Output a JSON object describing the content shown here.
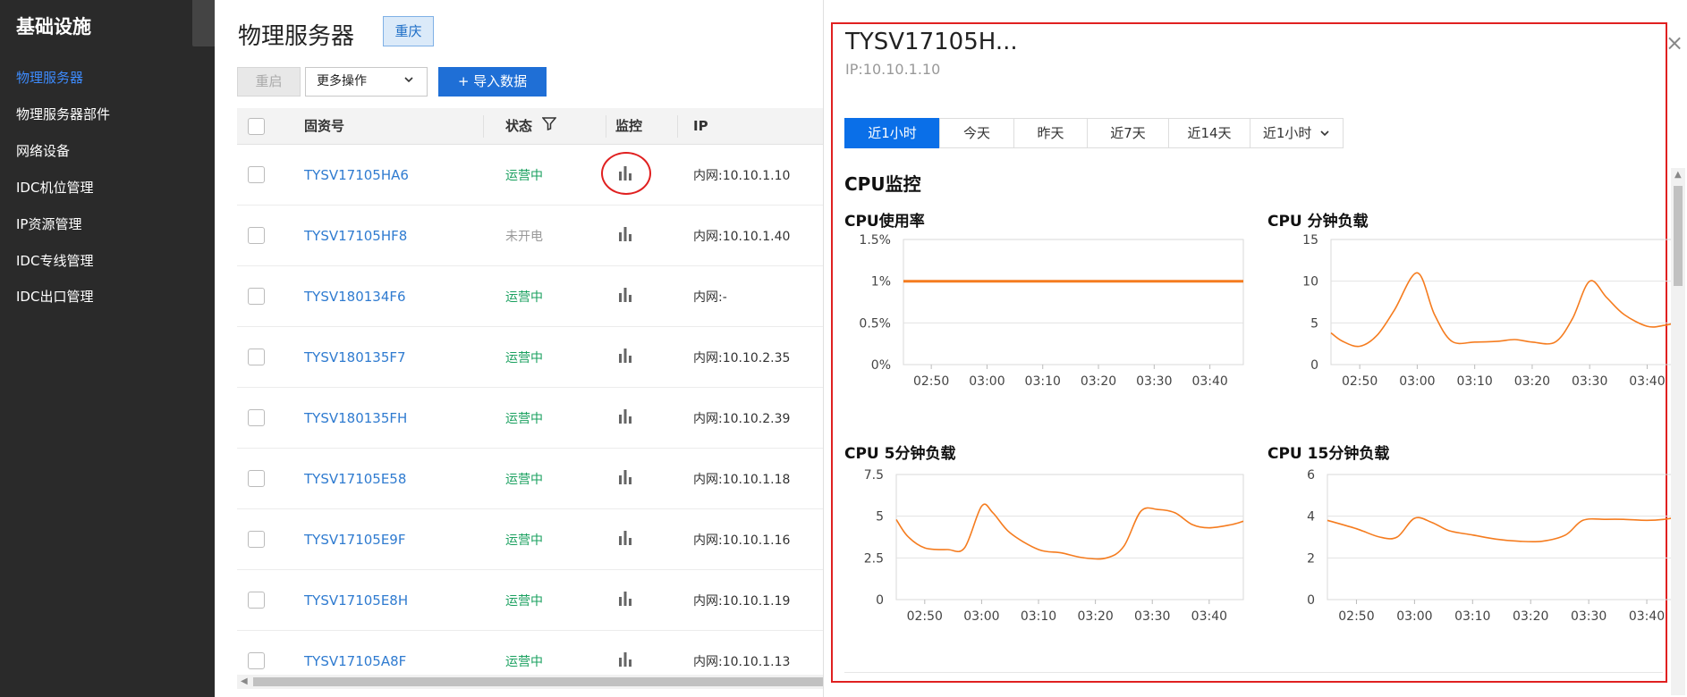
{
  "sidebar": {
    "title": "基础设施",
    "items": [
      {
        "label": "物理服务器",
        "active": true
      },
      {
        "label": "物理服务器部件"
      },
      {
        "label": "网络设备"
      },
      {
        "label": "IDC机位管理"
      },
      {
        "label": "IP资源管理"
      },
      {
        "label": "IDC专线管理"
      },
      {
        "label": "IDC出口管理"
      }
    ]
  },
  "main": {
    "title": "物理服务器",
    "region": "重庆",
    "toolbar": {
      "restart": "重启",
      "more_ops": "更多操作",
      "import": "+ 导入数据"
    },
    "table": {
      "headers": {
        "asset": "固资号",
        "status": "状态",
        "monitor": "监控",
        "ip": "IP"
      },
      "rows": [
        {
          "asset": "TYSV17105HA6",
          "status": "运营中",
          "status_type": "run",
          "ip": "内网:10.10.1.10"
        },
        {
          "asset": "TYSV17105HF8",
          "status": "未开电",
          "status_type": "off",
          "ip": "内网:10.10.1.40"
        },
        {
          "asset": "TYSV180134F6",
          "status": "运营中",
          "status_type": "run",
          "ip": "内网:-"
        },
        {
          "asset": "TYSV180135F7",
          "status": "运营中",
          "status_type": "run",
          "ip": "内网:10.10.2.35"
        },
        {
          "asset": "TYSV180135FH",
          "status": "运营中",
          "status_type": "run",
          "ip": "内网:10.10.2.39"
        },
        {
          "asset": "TYSV17105E58",
          "status": "运营中",
          "status_type": "run",
          "ip": "内网:10.10.1.18"
        },
        {
          "asset": "TYSV17105E9F",
          "status": "运营中",
          "status_type": "run",
          "ip": "内网:10.10.1.16"
        },
        {
          "asset": "TYSV17105E8H",
          "status": "运营中",
          "status_type": "run",
          "ip": "内网:10.10.1.19"
        },
        {
          "asset": "TYSV17105A8F",
          "status": "运营中",
          "status_type": "run",
          "ip": "内网:10.10.1.13"
        }
      ]
    }
  },
  "panel": {
    "title": "TYSV17105H...",
    "ip": "IP:10.10.1.10",
    "tabs": [
      {
        "label": "近1小时",
        "active": true
      },
      {
        "label": "今天"
      },
      {
        "label": "昨天"
      },
      {
        "label": "近7天"
      },
      {
        "label": "近14天"
      },
      {
        "label": "近1小时",
        "dropdown": true
      }
    ],
    "section_title": "CPU监控",
    "close": "×"
  },
  "colors": {
    "line": "#f57c1f",
    "accent": "#0a6fe8",
    "link": "#2f7bd0",
    "running": "#1aa05f",
    "highlight": "#e02020"
  },
  "chart_data": [
    {
      "type": "line",
      "title": "CPU使用率",
      "x": [
        "02:45",
        "02:50",
        "03:00",
        "03:10",
        "03:20",
        "03:30",
        "03:40",
        "03:46"
      ],
      "xticks": [
        "02:50",
        "03:00",
        "03:10",
        "03:20",
        "03:30",
        "03:40"
      ],
      "yticks": [
        "1.5%",
        "1%",
        "0.5%",
        "0%"
      ],
      "ylim": [
        0,
        1.5
      ],
      "series": [
        {
          "values": [
            1,
            1,
            1,
            1,
            1,
            1,
            1,
            1
          ]
        }
      ],
      "grid": true
    },
    {
      "type": "line",
      "title": "CPU 分钟负载",
      "x": [
        "02:45",
        "02:47",
        "02:50",
        "02:53",
        "02:56",
        "03:00",
        "03:03",
        "03:06",
        "03:10",
        "03:14",
        "03:17",
        "03:20",
        "03:24",
        "03:27",
        "03:30",
        "03:33",
        "03:36",
        "03:40",
        "03:43",
        "03:46"
      ],
      "xticks": [
        "02:50",
        "03:00",
        "03:10",
        "03:20",
        "03:30",
        "03:40"
      ],
      "yticks": [
        "15",
        "10",
        "5",
        "0"
      ],
      "ylim": [
        0,
        15
      ],
      "series": [
        {
          "values": [
            3.8,
            2.8,
            2.2,
            3.5,
            6.5,
            11,
            6,
            2.8,
            2.7,
            2.8,
            3,
            2.7,
            2.7,
            5.5,
            10,
            8,
            6,
            4.6,
            4.7,
            5.2
          ]
        }
      ],
      "grid": true
    },
    {
      "type": "line",
      "title": "CPU 5分钟负载",
      "x": [
        "02:45",
        "02:47",
        "02:50",
        "02:54",
        "02:57",
        "03:00",
        "03:02",
        "03:05",
        "03:10",
        "03:14",
        "03:18",
        "03:22",
        "03:25",
        "03:28",
        "03:31",
        "03:34",
        "03:37",
        "03:40",
        "03:44",
        "03:46"
      ],
      "xticks": [
        "02:50",
        "03:00",
        "03:10",
        "03:20",
        "03:30",
        "03:40"
      ],
      "yticks": [
        "7.5",
        "5",
        "2.5",
        "0"
      ],
      "ylim": [
        0,
        7.5
      ],
      "series": [
        {
          "values": [
            4.8,
            3.8,
            3.1,
            3,
            3.1,
            5.6,
            5.2,
            4,
            3,
            2.8,
            2.5,
            2.5,
            3.2,
            5.3,
            5.4,
            5.2,
            4.5,
            4.3,
            4.5,
            4.7
          ]
        }
      ],
      "grid": true
    },
    {
      "type": "line",
      "title": "CPU 15分钟负载",
      "x": [
        "02:45",
        "02:50",
        "02:54",
        "02:57",
        "03:00",
        "03:03",
        "03:06",
        "03:10",
        "03:14",
        "03:18",
        "03:22",
        "03:26",
        "03:29",
        "03:33",
        "03:36",
        "03:40",
        "03:43",
        "03:46"
      ],
      "xticks": [
        "02:50",
        "03:00",
        "03:10",
        "03:20",
        "03:30",
        "03:40"
      ],
      "yticks": [
        "6",
        "4",
        "2",
        "0"
      ],
      "ylim": [
        0,
        6
      ],
      "series": [
        {
          "values": [
            3.8,
            3.4,
            3,
            3,
            3.9,
            3.7,
            3.3,
            3.1,
            2.9,
            2.8,
            2.8,
            3.1,
            3.8,
            3.85,
            3.85,
            3.8,
            3.85,
            4
          ]
        }
      ],
      "grid": true
    }
  ]
}
